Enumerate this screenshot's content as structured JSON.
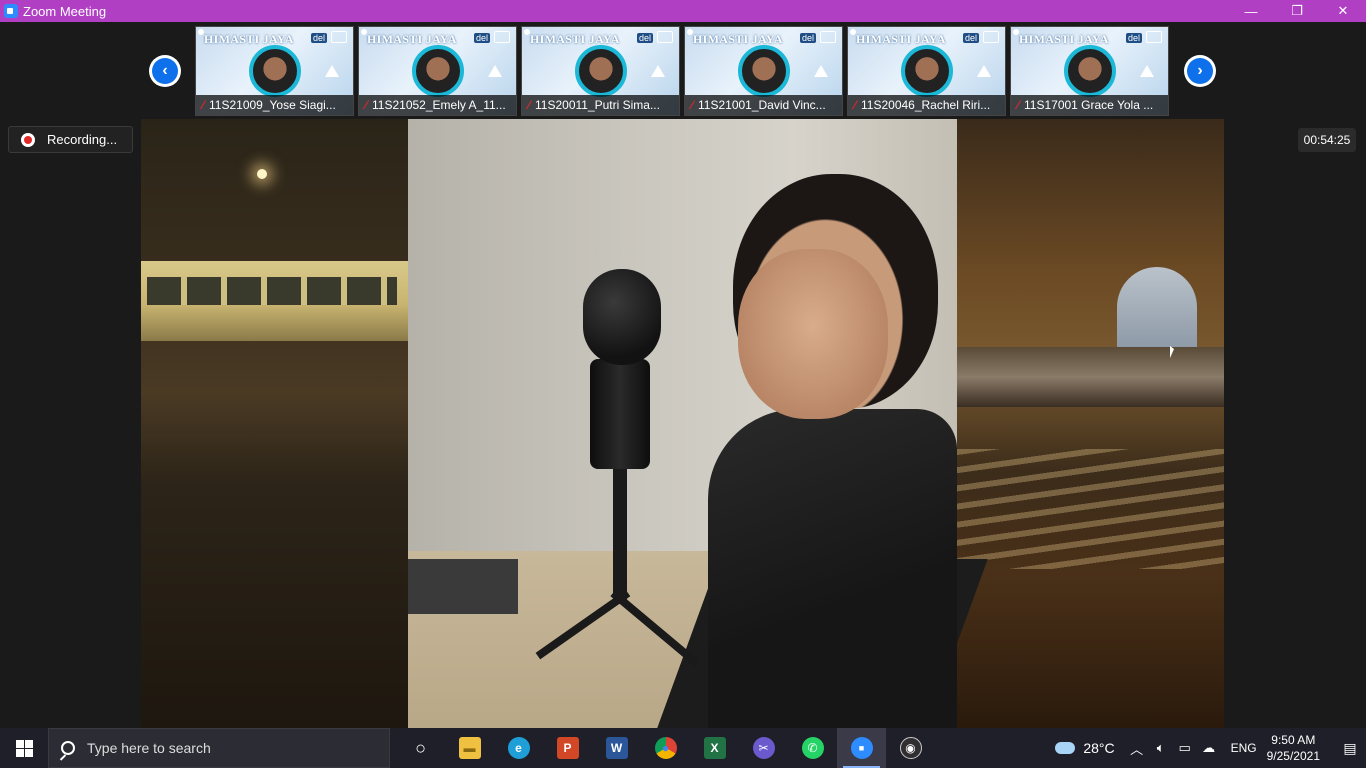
{
  "window": {
    "title": "Zoom Meeting",
    "controls": {
      "minimize": "—",
      "restore": "❐",
      "close": "✕"
    }
  },
  "participants": [
    {
      "name": "11S21009_Yose Siagi..."
    },
    {
      "name": "11S21052_Emely A_11..."
    },
    {
      "name": "11S20011_Putri Sima..."
    },
    {
      "name": "11S21001_David Vinc..."
    },
    {
      "name": "11S20046_Rachel Riri..."
    },
    {
      "name": "11S17001 Grace Yola ..."
    }
  ],
  "thumb_banner": "HIMASTI JAYA",
  "thumb_logo": "del",
  "nav": {
    "prev": "‹",
    "next": "›"
  },
  "recording": {
    "label": "Recording..."
  },
  "timer": {
    "value": "00:54:25"
  },
  "taskbar": {
    "search_placeholder": "Type here to search",
    "apps": [
      {
        "name": "cortana",
        "glyph": "○",
        "color": "#1f1f2a"
      },
      {
        "name": "file-explorer",
        "glyph": "▬",
        "color": "#f0c040"
      },
      {
        "name": "edge",
        "glyph": "e",
        "color": "#1e9fd8"
      },
      {
        "name": "powerpoint",
        "glyph": "P",
        "color": "#d24726"
      },
      {
        "name": "word",
        "glyph": "W",
        "color": "#2b579a"
      },
      {
        "name": "chrome",
        "glyph": "●",
        "color": "#db4437"
      },
      {
        "name": "excel",
        "glyph": "X",
        "color": "#217346"
      },
      {
        "name": "snip-sketch",
        "glyph": "✂",
        "color": "#6a5acd"
      },
      {
        "name": "whatsapp",
        "glyph": "✆",
        "color": "#25d366"
      },
      {
        "name": "zoom",
        "glyph": "■",
        "color": "#2d8cff"
      },
      {
        "name": "obs",
        "glyph": "◉",
        "color": "#302e31"
      }
    ],
    "weather": "28°C",
    "language": "ENG",
    "time": "9:50 AM",
    "date": "9/25/2021"
  }
}
